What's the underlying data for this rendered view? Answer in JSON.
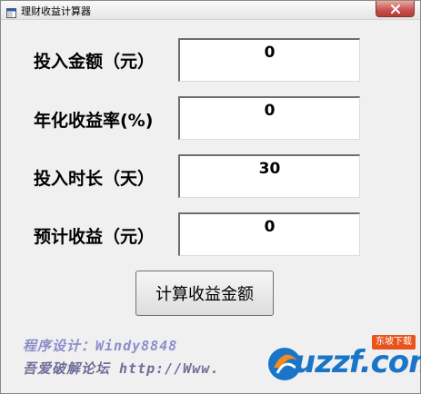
{
  "window": {
    "title": "理财收益计算器",
    "icons": {
      "app": "window-app-icon",
      "close": "close-icon"
    }
  },
  "form": {
    "fields": [
      {
        "label": "投入金额（元）",
        "value": "0"
      },
      {
        "label": "年化收益率(%)",
        "value": "0"
      },
      {
        "label": "投入时长（天）",
        "value": "30"
      },
      {
        "label": "预计收益（元）",
        "value": "0"
      }
    ],
    "calculate_label": "计算收益金额"
  },
  "footer": {
    "credit_line": "程序设计：Windy8848",
    "forum_line": "吾爱破解论坛  http://Www.",
    "watermark_text": "uzzf.com",
    "watermark_badge": "东坡下载"
  },
  "colors": {
    "credit_text": "#8c8ccc",
    "watermark_blue": "#1a74c8",
    "watermark_orange": "#e8541c"
  }
}
